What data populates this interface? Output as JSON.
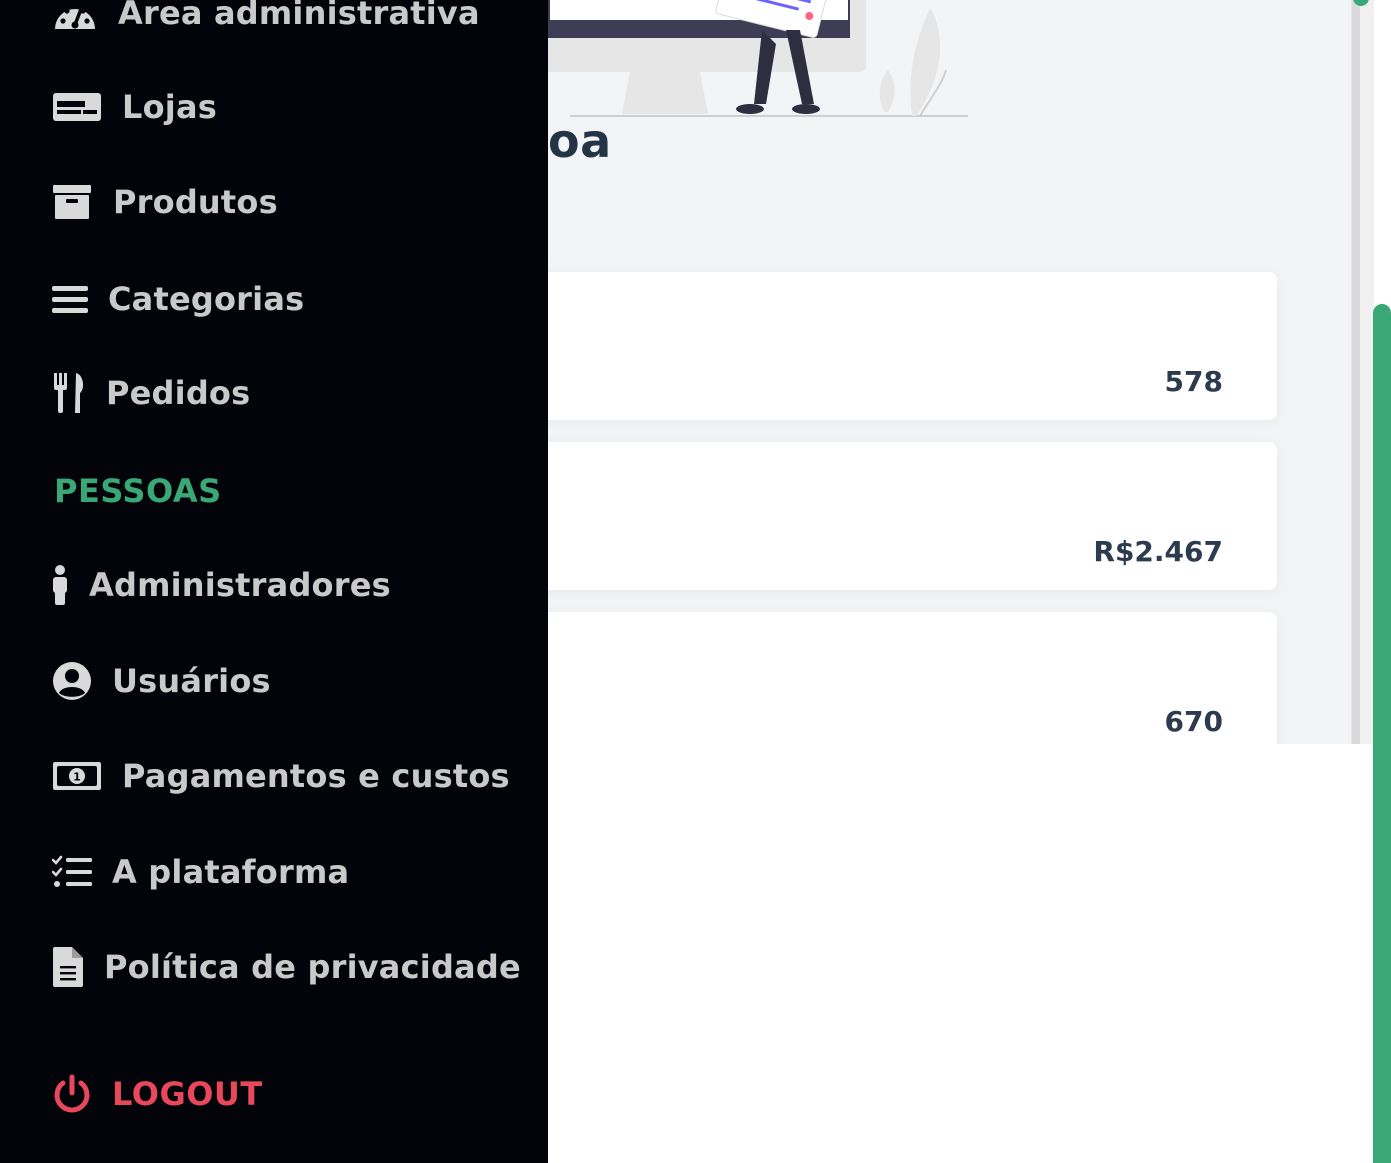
{
  "sidebar": {
    "items": [
      {
        "label": "Área administrativa",
        "icon": "dashboard-gauge-icon"
      },
      {
        "label": "Lojas",
        "icon": "storefront-icon"
      },
      {
        "label": "Produtos",
        "icon": "archive-box-icon"
      },
      {
        "label": "Categorias",
        "icon": "bars-list-icon"
      },
      {
        "label": "Pedidos",
        "icon": "utensils-icon"
      }
    ],
    "section_people": "PESSOAS",
    "people_items": [
      {
        "label": "Administradores",
        "icon": "person-icon"
      },
      {
        "label": "Usuários",
        "icon": "user-circle-icon"
      },
      {
        "label": "Pagamentos e custos",
        "icon": "money-bill-icon"
      },
      {
        "label": "A plataforma",
        "icon": "checklist-icon"
      },
      {
        "label": "Política de privacidade",
        "icon": "document-icon"
      }
    ],
    "logout": {
      "label": "LOGOUT",
      "icon": "power-icon"
    }
  },
  "main": {
    "heading_fragment": "oa",
    "stats": [
      {
        "value": "578"
      },
      {
        "value": "R$2.467"
      },
      {
        "value": "670"
      }
    ]
  },
  "colors": {
    "sidebar_bg": "#020409",
    "accent_green": "#3aa876",
    "logout_red": "#e8475c",
    "content_bg": "#f3f4f6",
    "text_dark": "#2d3b4e"
  }
}
